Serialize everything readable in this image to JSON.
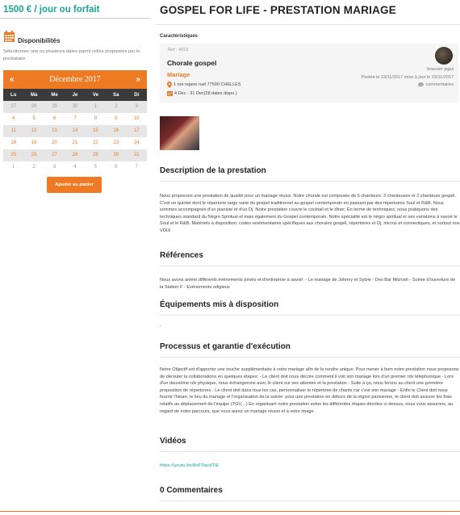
{
  "price": "1500 € / jour ou forfait",
  "availability": {
    "title": "Disponibilités",
    "description": "Sélectionner une ou plusieurs dates parmi celles proposées par le prestataire."
  },
  "calendar": {
    "prev": "«",
    "next": "»",
    "month": "Décembre 2017",
    "weekdays": [
      "Lu",
      "Ma",
      "Me",
      "Je",
      "Ve",
      "Sa",
      "Di"
    ],
    "days": [
      {
        "t": "27",
        "s": "muted"
      },
      {
        "t": "28",
        "s": "muted"
      },
      {
        "t": "29",
        "s": "muted"
      },
      {
        "t": "30",
        "s": "muted"
      },
      {
        "t": "1",
        "s": "muted"
      },
      {
        "t": "2",
        "s": "muted"
      },
      {
        "t": "3",
        "s": "muted"
      },
      {
        "t": "4",
        "s": "avail"
      },
      {
        "t": "5",
        "s": "avail"
      },
      {
        "t": "6",
        "s": "avail"
      },
      {
        "t": "7",
        "s": "avail"
      },
      {
        "t": "8",
        "s": "avail"
      },
      {
        "t": "9",
        "s": "avail"
      },
      {
        "t": "10",
        "s": "avail"
      },
      {
        "t": "11",
        "s": "avail"
      },
      {
        "t": "12",
        "s": "avail"
      },
      {
        "t": "13",
        "s": "avail"
      },
      {
        "t": "14",
        "s": "avail"
      },
      {
        "t": "15",
        "s": "avail"
      },
      {
        "t": "16",
        "s": "avail"
      },
      {
        "t": "17",
        "s": "avail"
      },
      {
        "t": "18",
        "s": "avail"
      },
      {
        "t": "19",
        "s": "avail"
      },
      {
        "t": "20",
        "s": "avail"
      },
      {
        "t": "21",
        "s": "avail"
      },
      {
        "t": "22",
        "s": "avail"
      },
      {
        "t": "23",
        "s": "avail"
      },
      {
        "t": "24",
        "s": "avail"
      },
      {
        "t": "25",
        "s": "avail"
      },
      {
        "t": "26",
        "s": "avail"
      },
      {
        "t": "27",
        "s": "avail"
      },
      {
        "t": "28",
        "s": "avail"
      },
      {
        "t": "29",
        "s": "avail"
      },
      {
        "t": "30",
        "s": "avail"
      },
      {
        "t": "31",
        "s": "avail"
      },
      {
        "t": "1",
        "s": "muted"
      },
      {
        "t": "2",
        "s": "muted"
      },
      {
        "t": "3",
        "s": "muted"
      },
      {
        "t": "4",
        "s": "muted"
      },
      {
        "t": "5",
        "s": "muted"
      },
      {
        "t": "6",
        "s": "muted"
      },
      {
        "t": "7",
        "s": "muted"
      }
    ]
  },
  "cart_button": "Ajouter au panier",
  "title": "GOSPEL FOR LIFE - PRESTATION MARIAGE",
  "characteristics_label": "Caractéristiques",
  "card": {
    "ref": "Ref : 4910",
    "name": "Chorale gospel",
    "category": "Mariage",
    "address": "1 rue rejane ruel 77500 CHELLES",
    "dates": "4 Dec - 31 Dec(28 dates dispo.)",
    "author": "brassier jagui",
    "posted": "Postée le  23/11/2017 mise à jour le  23/11/2017",
    "comments": "commentaires"
  },
  "sections": {
    "description_title": "Description de la prestation",
    "description_text": "Nous proposons une prestation de qualité pour un mariage réussi. Notre chorale est composée de 5 chanteurs: 3 chanteuses et 2 chanteurs gospel. C'est un quintet dont le répertoire large varie du gospel traditionnel au gospel contemporain en passant par des répertoires Soul et R&B. Nous sommes accompagnés d'un pianiste et d'un Dj. Notre prestation couvre le cocktail et le dîner. En terme de techniques, nous pratiquons des techniques standard du Négro Spiritual et mais également du Gospel contemporain. Notre spécialité est le négro spiritual et ses variations à savoir le Soul et le R&B. Matériels à disposition: codes vestimentaires spécifiques aux chorales gospel, répertoires et Dj, micros et connectiques, et surtout nos VOIX",
    "references_title": "Références",
    "references_text": "Nous avons animé différents événements privés et d'entreprise à savoir: - Le mariage de Johnny et Sylvie - Des Bar Mitzvah - Soirée d'ouverture de la Station F - Evénements religieux",
    "equipment_title": "Équipements mis à disposition",
    "equipment_text": "-",
    "process_title": "Processus et garantie d'exécution",
    "process_text": "Notre Objectif est d'apporter une touche supplémentaire à votre mariage afin de le rendre unique. Pour mener à bien notre prestation nous proposons de dérouler la collaborations en quelques étapes: - Le client doit nous décrire comment il voit son mariage lors d'un premier rdv téléphonique - Lors d'un deuxième rdv physique, nous échangerons avec le client sur ses attentes et la prestation - Suite à ça, nous ferons au client une première proposition de répertoires - Le client doit dans tous les cas, personnaliser le répertoire de chants car c'est son mariage - Enfin le Client doit nous fournir l'heure, le lieu du mariage et l'organisation de la soirée: pour une prestation en dehors de la région parisienne, le client doit assurer les frais relatifs au déplacement de l'équipe (TGV,...) En organisant notre prestation selon les différentes étapes décrites ci-dessus, nous vous assurons, au regard de notre parcours, que vous aurez un mariage réussi et à votre image.",
    "videos_title": "Vidéos",
    "video_url": "https://youtu.be/8x6TiqcdTlE",
    "comments_title": "0 Commentaires"
  },
  "colors": {
    "accent": "#ee7a23",
    "teal": "#1aa596",
    "dark_bar": "#3a3a3a"
  }
}
